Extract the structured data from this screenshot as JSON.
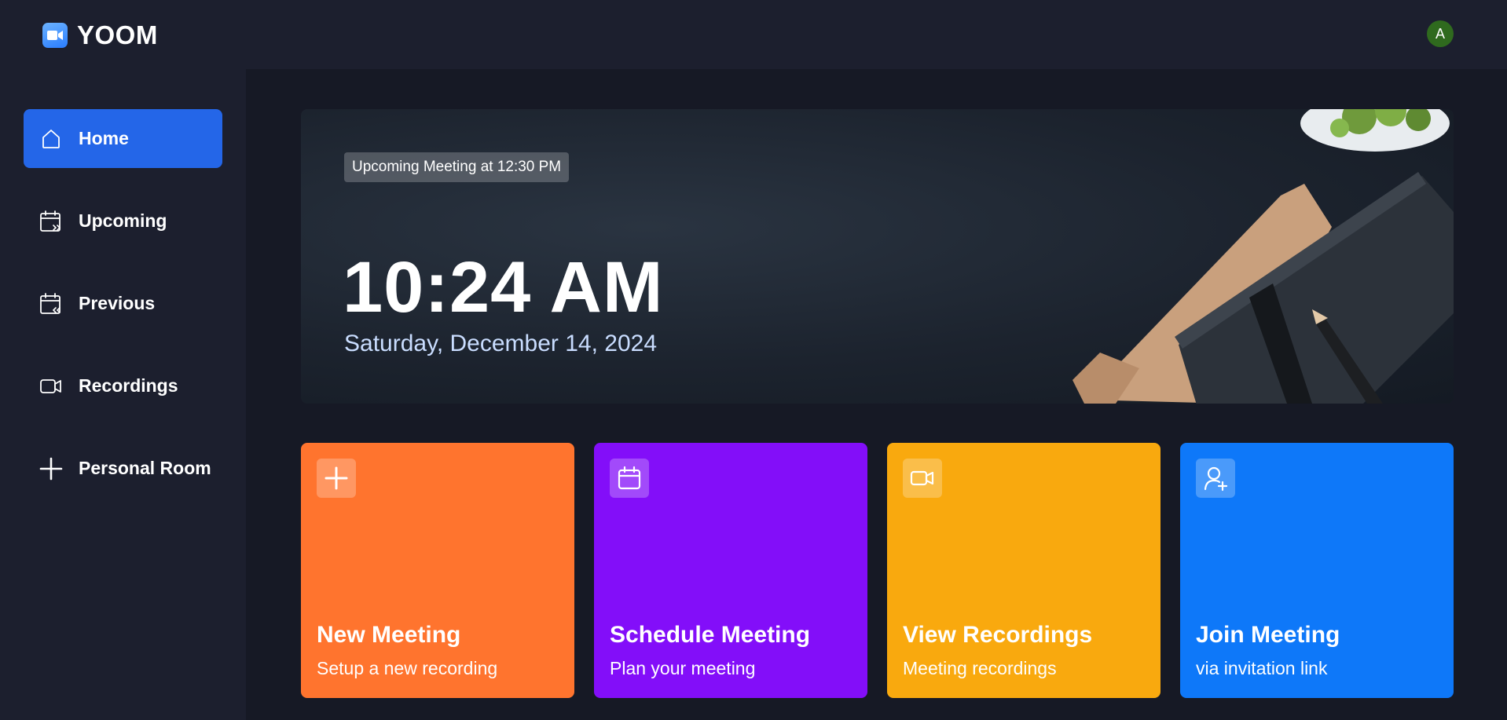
{
  "app": {
    "name": "YOOM",
    "avatar_initial": "A"
  },
  "sidebar": {
    "items": [
      {
        "label": "Home",
        "icon": "home-icon",
        "active": true
      },
      {
        "label": "Upcoming",
        "icon": "calendar-upcoming-icon"
      },
      {
        "label": "Previous",
        "icon": "calendar-previous-icon"
      },
      {
        "label": "Recordings",
        "icon": "video-icon"
      },
      {
        "label": "Personal Room",
        "icon": "plus-icon"
      }
    ]
  },
  "hero": {
    "badge": "Upcoming Meeting at 12:30 PM",
    "time": "10:24 AM",
    "date": "Saturday, December 14, 2024"
  },
  "cards": [
    {
      "title": "New Meeting",
      "subtitle": "Setup a new recording",
      "icon": "plus-icon",
      "color": "#ff742e"
    },
    {
      "title": "Schedule Meeting",
      "subtitle": "Plan your meeting",
      "icon": "calendar-icon",
      "color": "#830ef9"
    },
    {
      "title": "View Recordings",
      "subtitle": "Meeting recordings",
      "icon": "video-icon",
      "color": "#f9a90e"
    },
    {
      "title": "Join Meeting",
      "subtitle": "via invitation link",
      "icon": "add-user-icon",
      "color": "#0e78f9"
    }
  ],
  "colors": {
    "accent": "#2466e8",
    "background": "#161925",
    "panel": "#1c1f2e"
  }
}
